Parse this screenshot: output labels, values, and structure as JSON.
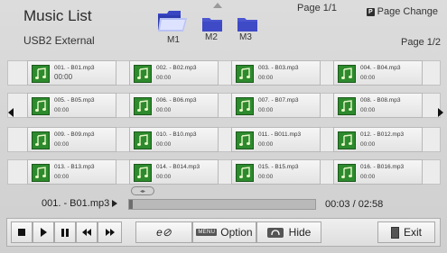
{
  "header": {
    "title": "Music List",
    "source": "USB2 External",
    "page_indicator": "Page 1/1",
    "page_change_badge": "P",
    "page_change_label": "Page Change",
    "pager": "Page 1/2"
  },
  "folders": [
    {
      "label": "M1",
      "state": "open"
    },
    {
      "label": "M2",
      "state": "closed"
    },
    {
      "label": "M3",
      "state": "closed"
    }
  ],
  "tracks": [
    {
      "name": "001. - B01.mp3",
      "duration": "00:00"
    },
    {
      "name": "002. - B02.mp3",
      "duration": "00:00"
    },
    {
      "name": "003. - B03.mp3",
      "duration": "00:00"
    },
    {
      "name": "004. - B04.mp3",
      "duration": "00:00"
    },
    {
      "name": "005. - B05.mp3",
      "duration": "00:00"
    },
    {
      "name": "006. - B06.mp3",
      "duration": "00:00"
    },
    {
      "name": "007. - B07.mp3",
      "duration": "00:00"
    },
    {
      "name": "008. - B08.mp3",
      "duration": "00:00"
    },
    {
      "name": "009. - B09.mp3",
      "duration": "00:00"
    },
    {
      "name": "010. - B10.mp3",
      "duration": "00:00"
    },
    {
      "name": "011. - B011.mp3",
      "duration": "00:00"
    },
    {
      "name": "012. - B012.mp3",
      "duration": "00:00"
    },
    {
      "name": "013. - B13.mp3",
      "duration": "00:00"
    },
    {
      "name": "014. - B014.mp3",
      "duration": "00:00"
    },
    {
      "name": "015. - B15.mp3",
      "duration": "00:00"
    },
    {
      "name": "016. - B016.mp3",
      "duration": "00:00"
    }
  ],
  "player": {
    "now_playing": "001. - B01.mp3",
    "time": "00:03 / 02:58",
    "progress_fraction": 0.017
  },
  "controls": {
    "option_badge": "MENU",
    "option_label": "Option",
    "hide_label": "Hide",
    "exit_label": "Exit",
    "repeat_glyph": "e⊘"
  },
  "colors": {
    "background": "#d4d4d4",
    "folder_blue": "#4a55d0",
    "music_icon_green": "#2d8a2d"
  }
}
